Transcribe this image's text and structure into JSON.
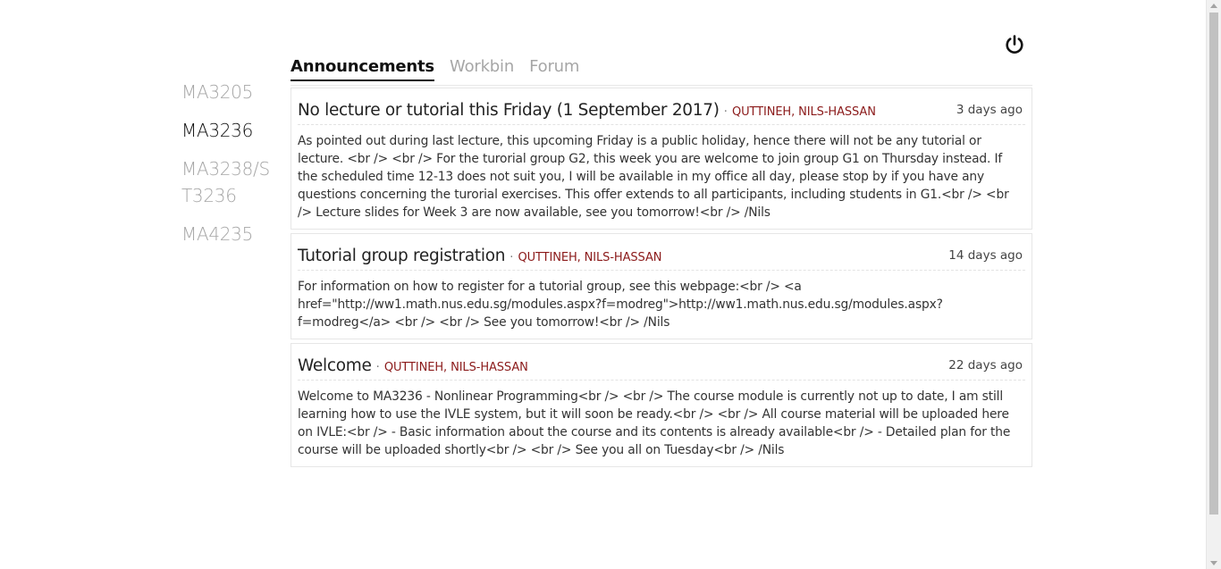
{
  "sidebar": {
    "modules": [
      "MA3205",
      "MA3236",
      "MA3238/ST3236",
      "MA4235"
    ]
  },
  "tabs": [
    "Announcements",
    "Workbin",
    "Forum"
  ],
  "announcements": [
    {
      "title": "No lecture or tutorial this Friday (1 September 2017)",
      "separator": "·",
      "author": "QUTTINEH, NILS-HASSAN",
      "time": "3 days ago",
      "body": "As pointed out during last lecture, this upcoming Friday is a public holiday, hence there will not be any tutorial or lecture. <br /> <br /> For the turorial group G2, this week you are welcome to join group G1 on Thursday instead. If the scheduled time 12-13 does not suit you, I will be available in my office all day, please stop by if you have any questions concerning the turorial exercises. This offer extends to all participants, including students in G1.<br /> <br /> Lecture slides for Week 3 are now available, see you tomorrow!<br /> /Nils"
    },
    {
      "title": "Tutorial group registration",
      "separator": "·",
      "author": "QUTTINEH, NILS-HASSAN",
      "time": "14 days ago",
      "body": "For information on how to register for a tutorial group, see this webpage:<br /> <a href=\"http://ww1.math.nus.edu.sg/modules.aspx?f=modreg\">http://ww1.math.nus.edu.sg/modules.aspx?f=modreg</a> <br /> <br /> See you tomorrow!<br /> /Nils"
    },
    {
      "title": "Welcome",
      "separator": "·",
      "author": "QUTTINEH, NILS-HASSAN",
      "time": "22 days ago",
      "body": "Welcome to MA3236 - Nonlinear Programming<br /> <br /> The course module is currently not up to date, I am still learning how to use the IVLE system, but it will soon be ready.<br /> <br /> All course material will be uploaded here on IVLE:<br /> - Basic information about the course and its contents is already available<br /> - Detailed plan for the course will be uploaded shortly<br /> <br /> See you all on Tuesday<br /> /Nils"
    }
  ],
  "icons": {
    "power": "power-icon"
  }
}
